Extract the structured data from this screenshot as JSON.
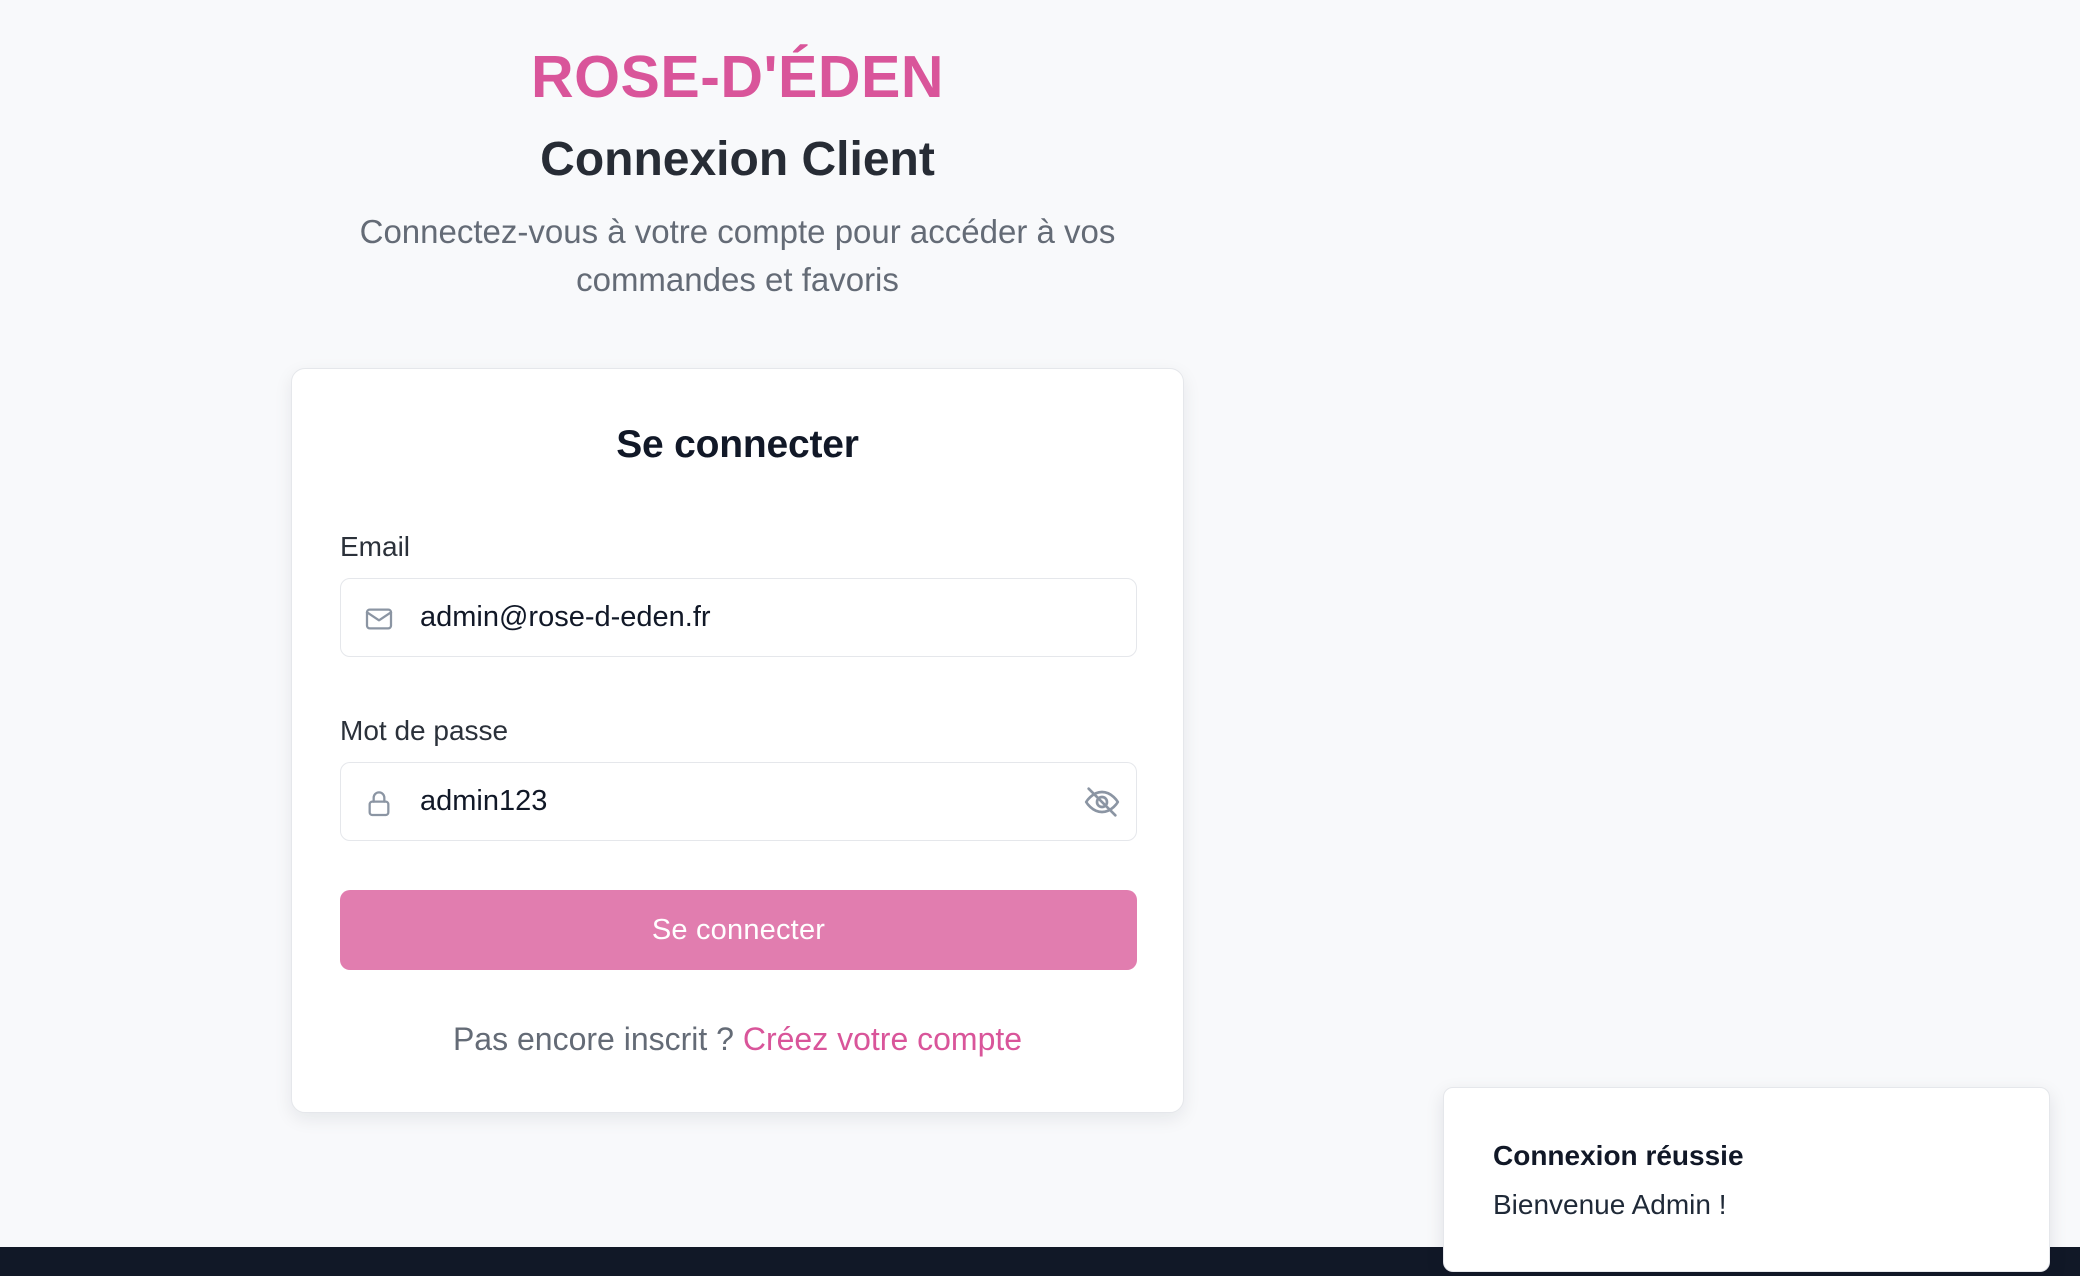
{
  "brand": {
    "name": "ROSE-D'ÉDEN"
  },
  "page": {
    "title": "Connexion Client",
    "subtitle": "Connectez-vous à votre compte pour accéder à vos commandes et favoris"
  },
  "login_form": {
    "title": "Se connecter",
    "email": {
      "label": "Email",
      "value": "admin@rose-d-eden.fr",
      "icon": "mail-icon"
    },
    "password": {
      "label": "Mot de passe",
      "value": "admin123",
      "icon": "lock-icon",
      "visibility_icon": "eye-off-icon"
    },
    "submit_label": "Se connecter",
    "register_prompt": "Pas encore inscrit ?",
    "register_link_label": "Créez votre compte"
  },
  "toast": {
    "title": "Connexion réussie",
    "message": "Bienvenue Admin !"
  },
  "colors": {
    "brand_pink": "#d9559a",
    "button_pink": "#e17daf",
    "footer_dark": "#111827"
  }
}
